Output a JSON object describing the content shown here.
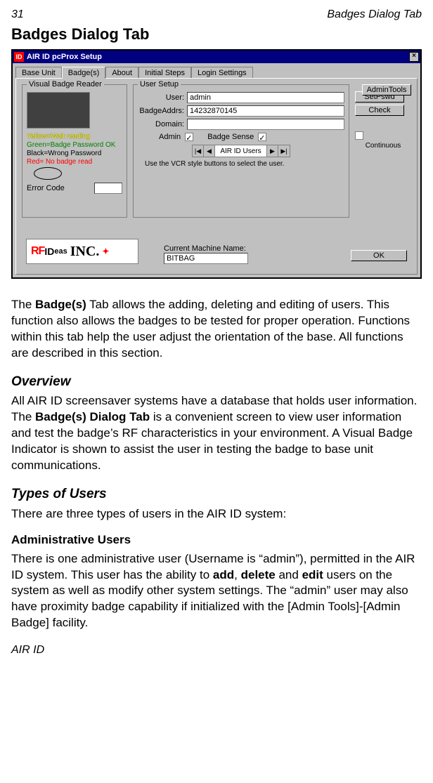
{
  "header": {
    "page_number": "31",
    "running_title": "Badges Dialog Tab"
  },
  "page_title": "Badges Dialog Tab",
  "window": {
    "title": "AIR ID pcProx Setup",
    "close_glyph": "×",
    "tabs": [
      "Base Unit",
      "Badge(s)",
      "About",
      "Initial Steps",
      "Login Settings"
    ],
    "active_tab_index": 1,
    "visual_reader": {
      "legend": "Visual Badge Reader",
      "status_yellow": "Yellow=Wait reading",
      "status_green": "Green=Badge Password OK",
      "status_black": "Black=Wrong Password",
      "status_red": "Red= No badge read",
      "error_label": "Error Code"
    },
    "user_setup": {
      "legend": "User Setup",
      "user_label": "User:",
      "user_value": "admin",
      "badge_label": "BadgeAddrs:",
      "badge_value": "14232870145",
      "domain_label": "Domain:",
      "domain_value": "",
      "admin_label": "Admin",
      "badge_sense_label": "Badge Sense",
      "continuous_label": "Continuous",
      "vcr_text": "AIR ID Users",
      "vcr_hint": "Use the VCR style buttons to select the user.",
      "vcr_first": "|◀",
      "vcr_prev": "◀",
      "vcr_next": "▶",
      "vcr_last": "▶|"
    },
    "buttons": {
      "setpswd": "SetPswd",
      "check": "Check",
      "admintools": "AdminTools",
      "ok": "OK"
    },
    "machine": {
      "label": "Current Machine Name:",
      "value": "BITBAG"
    },
    "logo": {
      "rf": "RF",
      "id": "ID",
      "eas": "eas",
      "inc": "INC.",
      "flag": "✦"
    }
  },
  "body": {
    "intro_pre": "The ",
    "intro_bold": "Badge(s)",
    "intro_post": " Tab allows the adding, deleting and editing of users. This function also allows the badges to be tested for proper operation.  Functions within this tab help the user adjust the orientation of the base. All functions are described in this section.",
    "overview_h": "Overview",
    "overview_pre": "All AIR ID screensaver systems have a database that holds user information.  The ",
    "overview_bold": "Badge(s) Dialog Tab",
    "overview_post": " is a convenient screen to view user information and test the badge’s RF characteristics in your environment.  A Visual Badge Indicator is shown to assist the user in testing the badge to base unit communications.",
    "types_h": "Types of Users",
    "types_p": "There are three types of users in the AIR ID system:",
    "admin_h": "Administrative Users",
    "admin_pre": "There is one administrative user (Username is “admin”), permitted in the AIR ID system.  This user has the ability to ",
    "admin_b1": "add",
    "admin_mid1": ", ",
    "admin_b2": "delete",
    "admin_mid2": " and ",
    "admin_b3": "edit",
    "admin_post": " users on the system as well as modify other system settings.  The “admin” user may also have proximity badge capability if initialized with the [Admin Tools]-[Admin Badge] facility."
  },
  "footer": "AIR ID"
}
